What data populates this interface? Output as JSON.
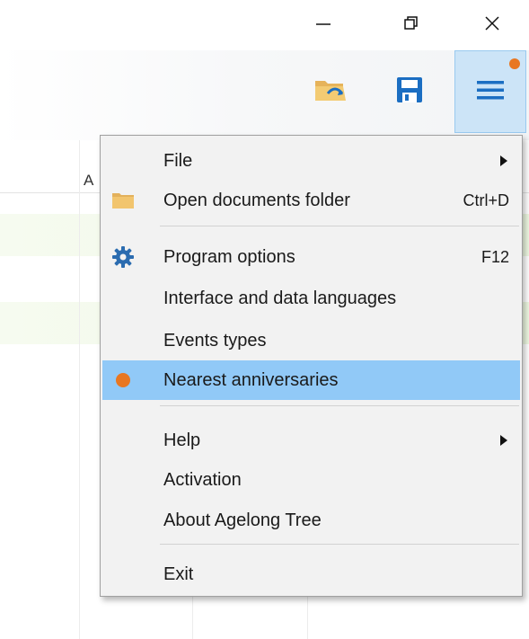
{
  "window": {
    "minimize_icon": "minimize-icon",
    "restore_icon": "restore-icon",
    "close_icon": "close-icon"
  },
  "toolbar": {
    "open_folder_icon": "folder-open-icon",
    "save_icon": "floppy-disk-icon",
    "menu_icon": "hamburger-menu-icon",
    "notification_color": "#e87722",
    "accent_color": "#1b6ec2"
  },
  "grid": {
    "column_letter": "A"
  },
  "menu": {
    "items": [
      {
        "label": "File",
        "shortcut": "",
        "submenu": true,
        "icon": ""
      },
      {
        "label": "Open documents folder",
        "shortcut": "Ctrl+D",
        "submenu": false,
        "icon": "folder-icon"
      },
      {
        "label": "Program options",
        "shortcut": "F12",
        "submenu": false,
        "icon": "gear-icon"
      },
      {
        "label": "Interface and data languages",
        "shortcut": "",
        "submenu": false,
        "icon": ""
      },
      {
        "label": "Events types",
        "shortcut": "",
        "submenu": false,
        "icon": ""
      },
      {
        "label": "Nearest anniversaries",
        "shortcut": "",
        "submenu": false,
        "icon": "orange-dot-icon",
        "selected": true
      },
      {
        "label": "Help",
        "shortcut": "",
        "submenu": true,
        "icon": ""
      },
      {
        "label": "Activation",
        "shortcut": "",
        "submenu": false,
        "icon": ""
      },
      {
        "label": "About Agelong Tree",
        "shortcut": "",
        "submenu": false,
        "icon": ""
      },
      {
        "label": "Exit",
        "shortcut": "",
        "submenu": false,
        "icon": ""
      }
    ],
    "selected_color": "#91c9f7"
  }
}
